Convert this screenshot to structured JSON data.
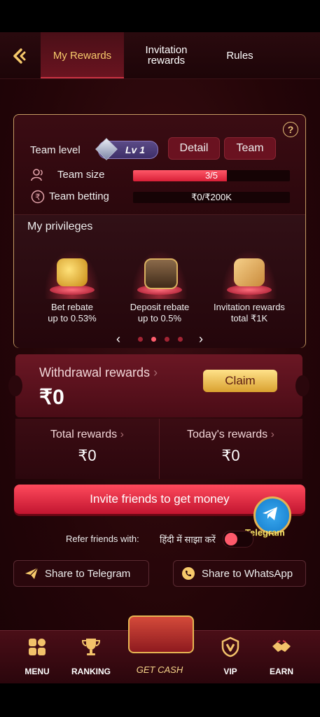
{
  "nav": {
    "tabs": [
      {
        "label": "My Rewards"
      },
      {
        "label": "Invitation rewards"
      },
      {
        "label": "Rules"
      }
    ]
  },
  "team": {
    "level_label": "Team level",
    "level_badge": "Lv 1",
    "detail_label": "Detail",
    "team_label": "Team",
    "size_label": "Team size",
    "size_value": "3/5",
    "size_progress": 0.6,
    "betting_label": "Team betting",
    "betting_value": "₹0/₹200K",
    "betting_progress": 0
  },
  "privileges": {
    "title": "My privileges",
    "items": [
      {
        "line1": "Bet rebate",
        "line2": "up to 0.53%"
      },
      {
        "line1": "Deposit rebate",
        "line2": "up to 0.5%"
      },
      {
        "line1": "Invitation rewards",
        "line2": "total ₹1K"
      }
    ],
    "active_page": 2,
    "pages": 4
  },
  "withdrawal": {
    "label": "Withdrawal rewards",
    "amount": "₹0",
    "claim_label": "Claim"
  },
  "totals": {
    "total_label": "Total rewards",
    "total_value": "₹0",
    "today_label": "Today's rewards",
    "today_value": "₹0"
  },
  "invite": {
    "button_label": "Invite friends to get money",
    "telegram_badge": "Telegram",
    "refer_label": "Refer friends with:",
    "refer_lang": "हिंदी में साझा करें"
  },
  "share": {
    "telegram": "Share to Telegram",
    "whatsapp": "Share to WhatsApp"
  },
  "bottom_nav": {
    "menu": "MENU",
    "ranking": "RANKING",
    "get_cash": "GET CASH",
    "vip": "VIP",
    "earn": "EARN"
  },
  "colors": {
    "accent": "#f6c96b",
    "primary_red": "#e42a3f",
    "bg": "#240508"
  }
}
